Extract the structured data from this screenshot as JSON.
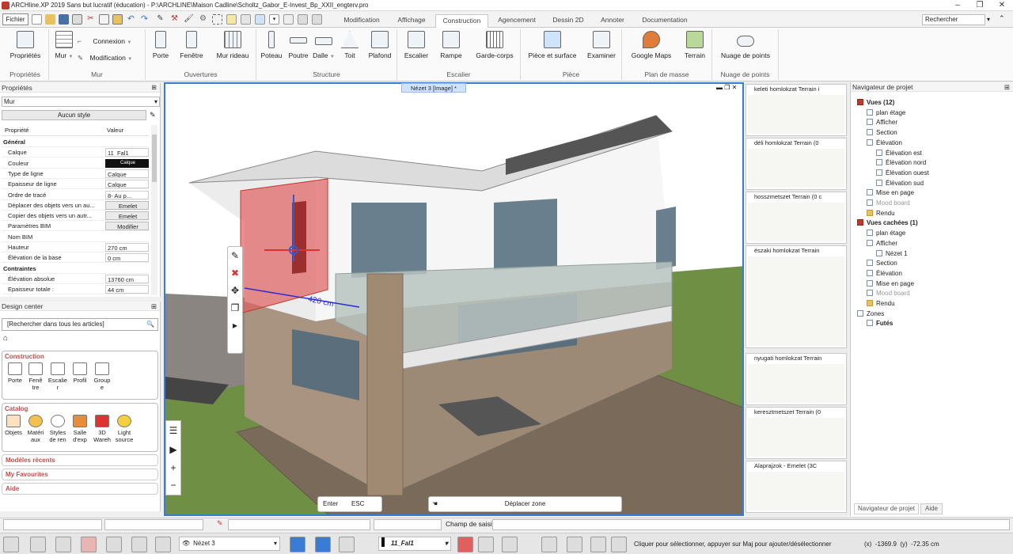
{
  "app": {
    "title": "ARCHline.XP 2019 Sans but lucratif (éducation) - P:\\ARCHLINE\\Maison Cadline\\Scholtz_Gabor_E-Invest_Bp_XXII_engterv.pro"
  },
  "menu": {
    "fichier": "Fichier",
    "tabs": [
      "Modification",
      "Affichage",
      "Construction",
      "Agencement",
      "Dessin 2D",
      "Annoter",
      "Documentation"
    ],
    "active_tab": "Construction",
    "search_placeholder": "Rechercher"
  },
  "ribbon": {
    "groups": {
      "proprietes": {
        "label": "Propriétés",
        "buttons": [
          "Propriétés"
        ]
      },
      "mur": {
        "label": "Mur",
        "buttons": [
          "Mur",
          "Connexion",
          "Modification"
        ]
      },
      "ouvertures": {
        "label": "Ouvertures",
        "buttons": [
          "Porte",
          "Fenêtre",
          "Mur rideau"
        ]
      },
      "structure": {
        "label": "Structure",
        "buttons": [
          "Poteau",
          "Poutre",
          "Dalle",
          "Toit",
          "Plafond"
        ]
      },
      "escalier": {
        "label": "Escalier",
        "buttons": [
          "Escalier",
          "Rampe",
          "Garde-corps"
        ]
      },
      "piece": {
        "label": "Pièce",
        "buttons": [
          "Pièce et surface",
          "Examiner"
        ]
      },
      "plan_masse": {
        "label": "Plan de masse",
        "buttons": [
          "Google Maps",
          "Terrain"
        ]
      },
      "nuage": {
        "label": "Nuage de points",
        "buttons": [
          "Nuage de points"
        ]
      }
    }
  },
  "properties": {
    "header": "Propriétés",
    "selector": "Mur",
    "style_button": "Aucun style",
    "col_property": "Propriété",
    "col_value": "Valeur",
    "rows": [
      {
        "k": "Général",
        "v": "",
        "section": true
      },
      {
        "k": "Calque",
        "v": "11_Fal1"
      },
      {
        "k": "Couleur",
        "v": "Calque"
      },
      {
        "k": "Type de ligne",
        "v": "Calque"
      },
      {
        "k": "Epaisseur de ligne",
        "v": "Calque"
      },
      {
        "k": "Ordre de tracé",
        "v": "8- Au p..."
      },
      {
        "k": "Déplacer des objets vers un au...",
        "v": "Emelet"
      },
      {
        "k": "Copier des objets vers un autr...",
        "v": "Emelet"
      },
      {
        "k": "Paramètres BIM",
        "v": "Modifier"
      },
      {
        "k": "Nom BIM",
        "v": ""
      },
      {
        "k": "Hauteur",
        "v": "270 cm"
      },
      {
        "k": "Élévation de la base",
        "v": "0 cm"
      },
      {
        "k": "Contraintes",
        "v": "",
        "section": true
      },
      {
        "k": "Élévation absolue",
        "v": "13760 cm"
      },
      {
        "k": "Epaisseur totale :",
        "v": "44 cm"
      }
    ]
  },
  "design_center": {
    "header": "Design center",
    "search_placeholder": "[Rechercher dans tous les articles]",
    "construction": {
      "title": "Construction",
      "items": [
        "Porte",
        "Fenê\ntre",
        "Escalie\nr",
        "Profil",
        "Group\ne"
      ]
    },
    "catalog": {
      "title": "Catalog",
      "items": [
        "Objets",
        "Matéri\naux",
        "Styles\nde ren",
        "Salle\nd'exp",
        "3D\nWareh",
        "Light\nsource"
      ]
    },
    "sections": [
      "Modèles récents",
      "My Favourites",
      "Aide"
    ]
  },
  "viewport": {
    "title": "Nézet 3 [Image] *",
    "dimension": "420 cm",
    "enter": "Enter",
    "esc": "ESC",
    "deplacer": "Déplacer zone"
  },
  "thumbnails": [
    "keleti homlokzat Terrain i",
    "déli homlokzat Terrain (0",
    "hosszmetszet Terrain (0 c",
    "északi homlokzat Terrain",
    "nyugati homlokzat Terrain",
    "keresztmetszet Terrain (0",
    "Alaprajzok - Emelet (3C"
  ],
  "navigator": {
    "header": "Navigateur de projet",
    "tree": [
      {
        "label": "Vues (12)",
        "level": 0,
        "bold": true,
        "icon": "views"
      },
      {
        "label": "plan étage",
        "level": 1,
        "icon": "plan"
      },
      {
        "label": "Afficher",
        "level": 1,
        "icon": "view"
      },
      {
        "label": "Section",
        "level": 1,
        "icon": "section"
      },
      {
        "label": "Élévation",
        "level": 1,
        "icon": "elevation"
      },
      {
        "label": "Élévation est",
        "level": 2,
        "icon": "page"
      },
      {
        "label": "Élévation nord",
        "level": 2,
        "icon": "page"
      },
      {
        "label": "Élévation ouest",
        "level": 2,
        "icon": "page"
      },
      {
        "label": "Élévation sud",
        "level": 2,
        "icon": "page"
      },
      {
        "label": "Mise en page",
        "level": 1,
        "icon": "page"
      },
      {
        "label": "Mood board",
        "level": 1,
        "icon": "page",
        "grey": true
      },
      {
        "label": "Rendu",
        "level": 1,
        "icon": "folder"
      },
      {
        "label": "Vues cachées (1)",
        "level": 0,
        "bold": true,
        "icon": "views"
      },
      {
        "label": "plan étage",
        "level": 1,
        "icon": "plan"
      },
      {
        "label": "Afficher",
        "level": 1,
        "icon": "view"
      },
      {
        "label": "Nézet 1",
        "level": 2,
        "icon": "page"
      },
      {
        "label": "Section",
        "level": 1,
        "icon": "section"
      },
      {
        "label": "Élévation",
        "level": 1,
        "icon": "elevation"
      },
      {
        "label": "Mise en page",
        "level": 1,
        "icon": "page"
      },
      {
        "label": "Mood board",
        "level": 1,
        "icon": "page",
        "grey": true
      },
      {
        "label": "Rendu",
        "level": 1,
        "icon": "folder"
      },
      {
        "label": "Zones",
        "level": 0,
        "icon": "zones"
      },
      {
        "label": "Futés",
        "level": 1,
        "bold": true,
        "icon": "smart"
      }
    ],
    "tabs": [
      "Navigateur de projet",
      "Aide"
    ]
  },
  "command": {
    "label": "Champ de saisie"
  },
  "status": {
    "view": "Nézet 3",
    "layer": "11_Fal1",
    "hint": "Cliquer pour sélectionner, appuyer sur Maj pour ajouter/désélectionner",
    "coords": "(x)  -1369.9  (y)  -72.35 cm"
  },
  "colors": {
    "accent": "#3a7bd5",
    "selection": "#e06060",
    "design_center_titles": "#c0504d",
    "lawn": "#6f8f45",
    "paving": "#7a6a5a"
  }
}
